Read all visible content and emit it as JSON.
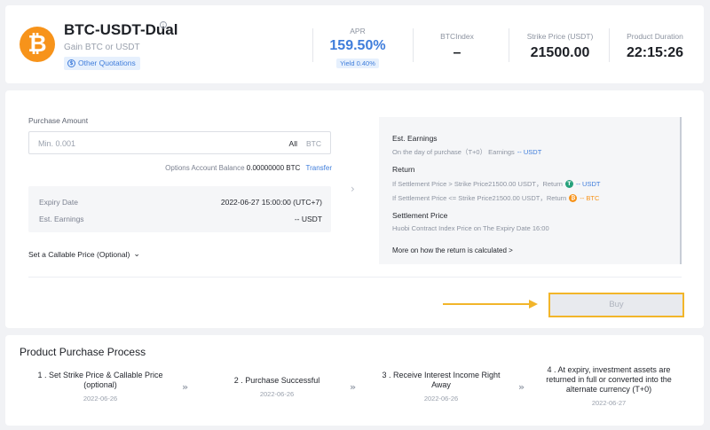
{
  "header": {
    "logo_glyph": "₿",
    "title": "BTC-USDT-Dual",
    "info_glyph": "i",
    "subtitle": "Gain BTC or USDT",
    "other_quotations_icon": "$",
    "other_quotations": "Other Quotations",
    "apr_label": "APR",
    "apr_value": "159.50%",
    "yield_badge": "Yield 0.40%",
    "btcindex_label": "BTCIndex",
    "btcindex_value": "–",
    "strike_label": "Strike Price (USDT)",
    "strike_value": "21500.00",
    "duration_label": "Product Duration",
    "duration_value": "22:15:26",
    "colors": {
      "accent_blue": "#3f7ddb",
      "btc_orange": "#f7931a"
    }
  },
  "purchase": {
    "amount_label": "Purchase Amount",
    "amount_placeholder": "Min. 0.001",
    "all_label": "All",
    "unit_label": "BTC",
    "balance_label": "Options Account Balance",
    "balance_value": "0.00000000 BTC",
    "transfer_label": "Transfer",
    "expiry_label": "Expiry Date",
    "expiry_value": "2022-06-27 15:00:00 (UTC+7)",
    "earnings_label": "Est. Earnings",
    "earnings_value": "-- USDT",
    "callable_label": "Set a Callable Price (Optional)",
    "callable_chevron": "⌄",
    "arrow_glyph": "›",
    "buy_label": "Buy",
    "pointer_color": "#f2b52a"
  },
  "info_panel": {
    "est_earnings_title": "Est. Earnings",
    "est_earnings_text": "On the day of purchase（T+0） Earnings",
    "est_earnings_value": "-- USDT",
    "return_title": "Return",
    "return_line1_text": "If Settlement Price > Strike Price21500.00 USDT，Return",
    "return_line1_coin": "T",
    "return_line1_value": "-- USDT",
    "return_line2_text": "If Settlement Price <= Strike Price21500.00 USDT，Return",
    "return_line2_coin": "₿",
    "return_line2_value": "-- BTC",
    "settlement_title": "Settlement Price",
    "settlement_text": "Huobi Contract Index Price on The Expiry Date 16:00",
    "more_link": "More on how the return is calculated >"
  },
  "process": {
    "title": "Product Purchase Process",
    "arrow_glyph": "»",
    "steps": [
      {
        "label": "1 . Set Strike Price & Callable Price (optional)",
        "date": "2022-06-26"
      },
      {
        "label": "2 . Purchase Successful",
        "date": "2022-06-26"
      },
      {
        "label": "3 . Receive Interest Income Right Away",
        "date": "2022-06-26"
      },
      {
        "label": "4 . At expiry, investment assets are returned in full or converted into the alternate currency (T+0)",
        "date": "2022-06-27"
      }
    ]
  }
}
